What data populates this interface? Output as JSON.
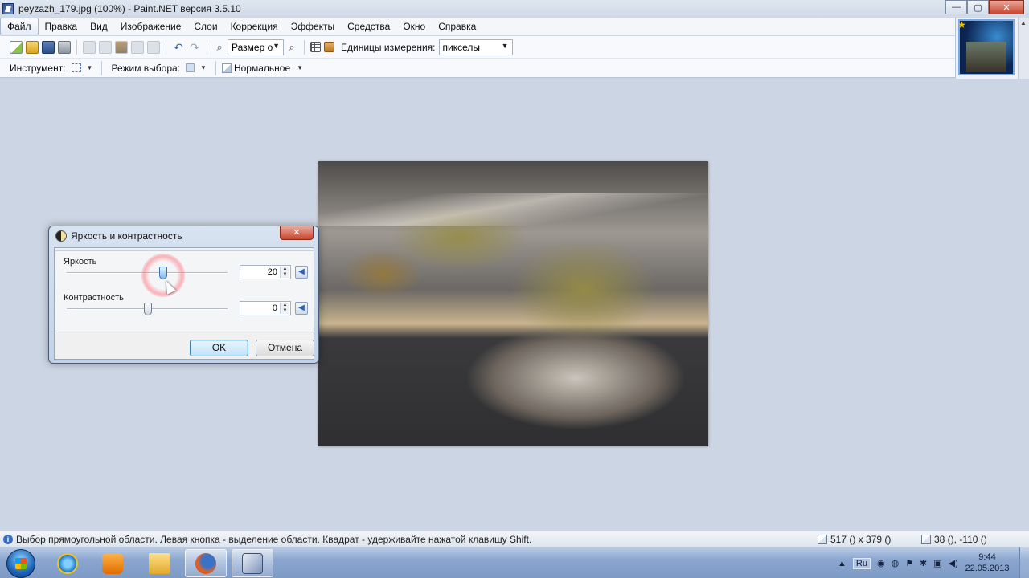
{
  "window": {
    "title": "peyzazh_179.jpg (100%) - Paint.NET версия 3.5.10",
    "minimize": "—",
    "maximize": "▢",
    "close": "✕"
  },
  "menu": [
    "Файл",
    "Правка",
    "Вид",
    "Изображение",
    "Слои",
    "Коррекция",
    "Эффекты",
    "Средства",
    "Окно",
    "Справка"
  ],
  "toolbar": {
    "zoom_dropdown": "Размер о",
    "units_label": "Единицы измерения:",
    "units_value": "пикселы"
  },
  "toolbar2": {
    "tool_label": "Инструмент:",
    "selection_mode_label": "Режим выбора:",
    "blend_mode": "Нормальное"
  },
  "dialog": {
    "title": "Яркость и контрастность",
    "brightness_label": "Яркость",
    "brightness_value": "20",
    "contrast_label": "Контрастность",
    "contrast_value": "0",
    "ok": "OK",
    "cancel": "Отмена",
    "close": "✕"
  },
  "status": {
    "message": "Выбор прямоугольной области. Левая кнопка - выделение области. Квадрат - удерживайте нажатой клавишу Shift.",
    "image_size": "517 () x 379 ()",
    "cursor_pos": "38 (), -110 ()"
  },
  "taskbar": {
    "language": "Ru",
    "time": "9:44",
    "date": "22.05.2013"
  }
}
